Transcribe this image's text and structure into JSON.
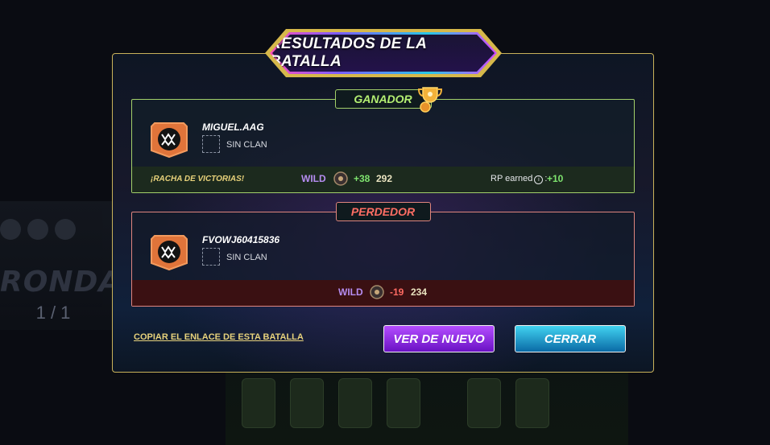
{
  "modal": {
    "title": "RESULTADOS DE LA BATALLA"
  },
  "winner": {
    "tag": "GANADOR",
    "name": "MIGUEL.AAG",
    "clan": "SIN CLAN",
    "streak": "¡RACHA DE VICTORIAS!",
    "league": "WILD",
    "delta": "+38",
    "rating": "292",
    "rp_label": "RP earned",
    "rp_info": "i",
    "rp_value": "+10"
  },
  "loser": {
    "tag": "PERDEDOR",
    "name": "FVOWJ60415836",
    "clan": "SIN CLAN",
    "league": "WILD",
    "delta": "-19",
    "rating": "234"
  },
  "footer": {
    "copy_link": "COPIAR EL ENLACE DE ESTA BATALLA",
    "replay_button": "VER DE NUEVO",
    "close_button": "CERRAR"
  },
  "background": {
    "round_label": "RONDA",
    "round_count": "1 / 1"
  },
  "colors": {
    "accent_gold": "#c9b25a",
    "winner_green": "#a3d06a",
    "loser_red": "#e0857e",
    "replay_purple": "#8a2be2",
    "close_cyan": "#1ea0d4"
  }
}
